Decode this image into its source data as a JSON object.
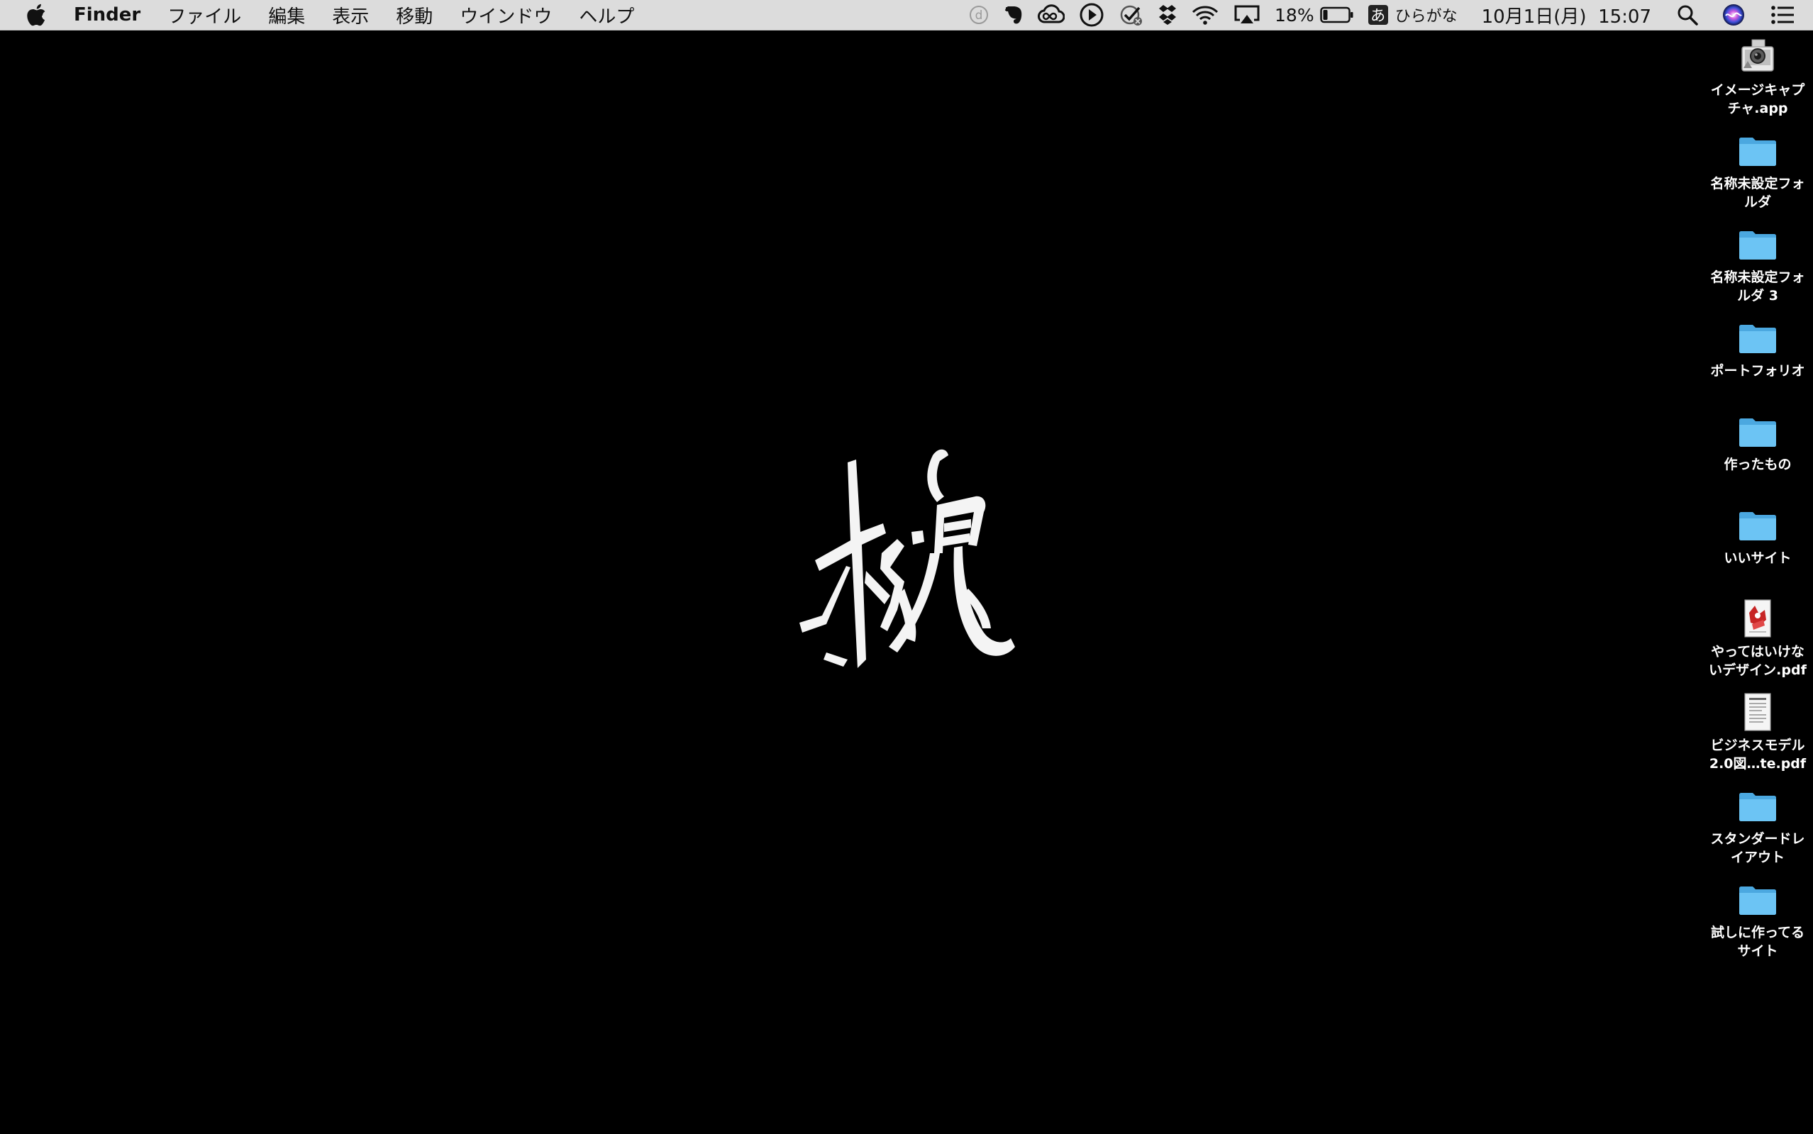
{
  "menubar": {
    "app_name": "Finder",
    "menus": [
      "ファイル",
      "編集",
      "表示",
      "移動",
      "ウインドウ",
      "ヘルプ"
    ],
    "status": {
      "battery_percent": "18%",
      "battery_level": 0.18,
      "ime_badge": "あ",
      "ime_label": "ひらがな",
      "datetime": "10月1日(月)  15:07"
    },
    "icons": [
      "apple-icon",
      "dictionary-icon",
      "evernote-icon",
      "creative-cloud-icon",
      "play-icon",
      "check-icon",
      "dropbox-icon",
      "wifi-icon",
      "airplay-icon",
      "battery-icon",
      "search-icon",
      "siri-icon",
      "notification-center-icon"
    ]
  },
  "desktop": {
    "items": [
      {
        "label": "イメージキャプチャ.app",
        "icon": "app-icon"
      },
      {
        "label": "名称未設定フォルダ",
        "icon": "folder-icon"
      },
      {
        "label": "名称未設定フォルダ 3",
        "icon": "folder-icon"
      },
      {
        "label": "ポートフォリオ",
        "icon": "folder-icon"
      },
      {
        "label": "作ったもの",
        "icon": "folder-icon"
      },
      {
        "label": "いいサイト",
        "icon": "folder-icon"
      },
      {
        "label": "やってはいけないデザイン.pdf",
        "icon": "pdf-icon"
      },
      {
        "label": "ビジネスモデル2.0図…te.pdf",
        "icon": "pdf-icon"
      },
      {
        "label": "スタンダードレイアウト",
        "icon": "folder-icon"
      },
      {
        "label": "試しに作ってるサイト",
        "icon": "folder-icon"
      }
    ],
    "colors": {
      "background": "#000000",
      "folder": "#6cc4f4",
      "menubar": "#dcdcdc"
    }
  }
}
